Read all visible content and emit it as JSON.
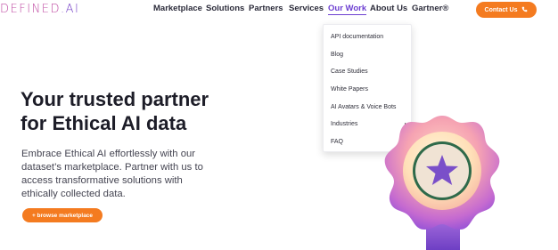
{
  "logo": {
    "text_a": "DEFINED",
    "text_b": ".AI"
  },
  "nav": {
    "items": [
      {
        "label": "Marketplace"
      },
      {
        "label": "Solutions"
      },
      {
        "label": "Partners"
      },
      {
        "label": "Services"
      },
      {
        "label": "Our Work"
      },
      {
        "label": "About Us"
      },
      {
        "label": "Gartner®"
      }
    ],
    "active": "Our Work",
    "contact_label": "Contact Us",
    "contact_icon": "phone-icon"
  },
  "dropdown": {
    "items": [
      {
        "label": "API documentation"
      },
      {
        "label": "Blog"
      },
      {
        "label": "Case Studies"
      },
      {
        "label": "White Papers"
      },
      {
        "label": "AI Avatars & Voice Bots"
      },
      {
        "label": "Industries",
        "caret": "▸"
      },
      {
        "label": "FAQ"
      }
    ]
  },
  "hero": {
    "title_lines": [
      "Your trusted partner",
      "for Ethical AI data"
    ],
    "subtitle_lines": [
      "Embrace Ethical AI effortlessly with our",
      "dataset’s marketplace. Partner with us to",
      "access transformative solutions with",
      "ethically collected data."
    ],
    "cta_label": "+ browse marketplace"
  },
  "colors": {
    "accent_orange": "#f47b20",
    "accent_purple": "#6d3fd1",
    "badge_pink": "#f3a6b4",
    "badge_purple": "#8a4fd6"
  }
}
